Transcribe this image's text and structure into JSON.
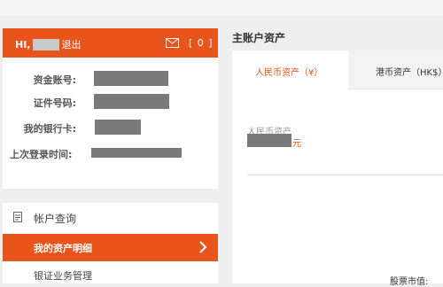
{
  "account": {
    "greeting": "HI,",
    "logout_label": "退出",
    "message_count": "[ 0 ]",
    "fields": [
      {
        "label": "资金账号:"
      },
      {
        "label": "证件号码:"
      },
      {
        "label": "我的银行卡:"
      },
      {
        "label": "上次登录时间:"
      }
    ]
  },
  "menu": {
    "title": "帐户查询",
    "items": [
      {
        "label": "我的资产明细",
        "active": true
      },
      {
        "label": "银证业务管理",
        "active": false
      }
    ]
  },
  "main": {
    "title": "主账户资产",
    "tabs": [
      {
        "label": "人民币资产（¥）",
        "active": true
      },
      {
        "label": "港币资产（HK$）",
        "active": false
      }
    ],
    "asset_label": "人民币资产",
    "currency_unit": "元",
    "partial_label": "股票市值:"
  },
  "colors": {
    "accent": "#e8541c",
    "mask": "#7a7a7a",
    "background": "#efefef"
  },
  "icons": {
    "mail": "envelope-icon",
    "document": "document-icon",
    "chevron": "chevron-right-icon"
  }
}
